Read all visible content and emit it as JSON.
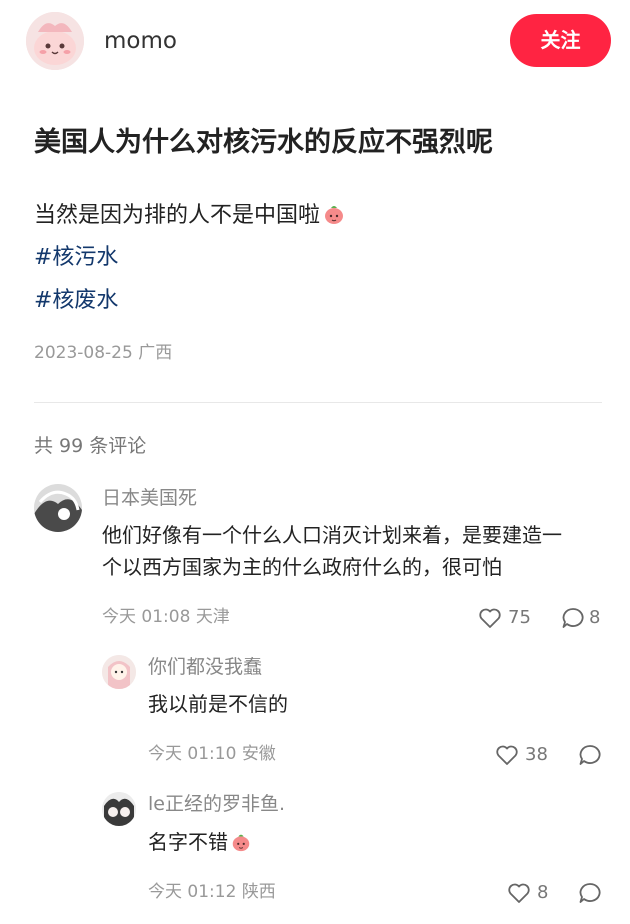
{
  "author": {
    "name": "momo",
    "follow_label": "关注"
  },
  "post": {
    "title": "美国人为什么对核污水的反应不强烈呢",
    "body": "当然是因为排的人不是中国啦",
    "tags": [
      "#核污水",
      "#核废水"
    ],
    "date": "2023-08-25",
    "location": "广西"
  },
  "comments_header": "共 99 条评论",
  "comments": [
    {
      "user": "日本美国死",
      "text_line1": "他们好像有一个什么人口消灭计划来着，是要建造一",
      "text_line2": "个以西方国家为主的什么政府什么的，很可怕",
      "time": "今天 01:08",
      "location": "天津",
      "likes": "75",
      "replies": "8"
    },
    {
      "user": "你们都没我蠢",
      "text": "我以前是不信的",
      "time": "今天 01:10",
      "location": "安徽",
      "likes": "38"
    },
    {
      "user": "le正经的罗非鱼.",
      "text": "名字不错",
      "time": "今天 01:12",
      "location": "陕西",
      "likes": "8"
    }
  ],
  "colors": {
    "accent": "#ff2442",
    "hashtag": "#13386c"
  }
}
